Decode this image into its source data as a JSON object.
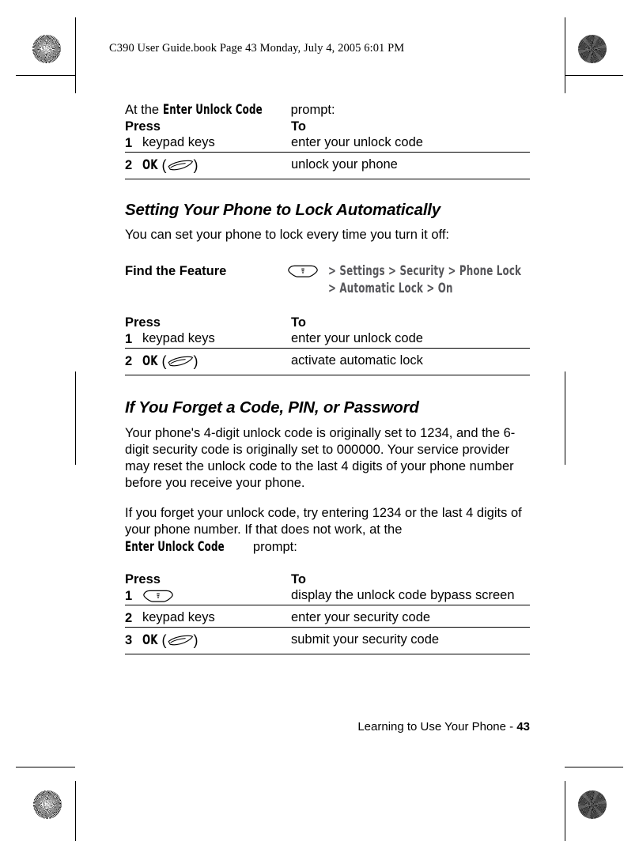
{
  "page_header": "C390 User Guide.book  Page 43  Monday, July 4, 2005  6:01 PM",
  "intro": {
    "before": "At the ",
    "term": "Enter Unlock Code",
    "after": " prompt:"
  },
  "table_unlock": {
    "header_press": "Press",
    "header_to": "To",
    "rows": [
      {
        "num": "1",
        "key": "keypad keys",
        "key_type": "text",
        "to": "enter your unlock code"
      },
      {
        "num": "2",
        "key": "OK",
        "key_type": "softkey",
        "to": "unlock your phone"
      }
    ]
  },
  "section_auto_lock": {
    "heading": "Setting Your Phone to Lock Automatically",
    "body": "You can set your phone to lock every time you turn it off:",
    "find_the_feature": {
      "label": "Find the Feature",
      "key_icon": "menu-key-icon",
      "path_line_1": "> Settings > Security > Phone Lock",
      "path_line_2": "> Automatic Lock > On"
    },
    "table": {
      "header_press": "Press",
      "header_to": "To",
      "rows": [
        {
          "num": "1",
          "key": "keypad keys",
          "key_type": "text",
          "to": "enter your unlock code"
        },
        {
          "num": "2",
          "key": "OK",
          "key_type": "softkey",
          "to": "activate automatic lock"
        }
      ]
    }
  },
  "section_forget": {
    "heading": "If You Forget a Code, PIN, or Password",
    "para1": "Your phone's 4-digit unlock code is originally set to 1234, and the 6-digit security code is originally set to 000000. Your service provider may reset the unlock code to the last 4 digits of your phone number before you receive your phone.",
    "para2": {
      "before": "If you forget your unlock code, try entering 1234 or the last 4 digits of your phone number. If that does not work, at the ",
      "term": "Enter Unlock Code",
      "after": " prompt:"
    },
    "table": {
      "header_press": "Press",
      "header_to": "To",
      "rows": [
        {
          "num": "1",
          "key": "",
          "key_type": "menukey",
          "to": "display the unlock code bypass screen"
        },
        {
          "num": "2",
          "key": "keypad keys",
          "key_type": "text",
          "to": "enter your security code"
        },
        {
          "num": "3",
          "key": "OK",
          "key_type": "softkey",
          "to": "submit your security code"
        }
      ]
    }
  },
  "footer": {
    "chapter": "Learning to Use Your Phone - ",
    "page_number": "43"
  },
  "colors": {
    "text": "#000000",
    "ui_term_gray": "#56565a",
    "rule": "#000000",
    "page_background": "#ffffff"
  }
}
